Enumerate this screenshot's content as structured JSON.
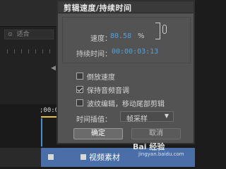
{
  "background": {
    "fit_label": "适合",
    "timecode": ";00:00",
    "clip_label": "视频素材"
  },
  "dialog": {
    "title": "剪辑速度/持续时间",
    "speed_label": "速度：",
    "speed_value": "80.58",
    "speed_unit": "%",
    "duration_label": "持续时间：",
    "duration_value": "00:00:03:13",
    "reverse_label": "倒放速度",
    "reverse_checked": false,
    "keep_pitch_label": "保持音频音调",
    "keep_pitch_checked": true,
    "ripple_label": "波纹编辑，移动尾部剪辑",
    "ripple_checked": false,
    "interpolation_label": "时间插值：",
    "interpolation_value": "帧采样",
    "ok_label": "确定",
    "cancel_label": "取消"
  },
  "watermark": {
    "text": "Bai 经验",
    "url": "jingyan.baidu.com"
  }
}
